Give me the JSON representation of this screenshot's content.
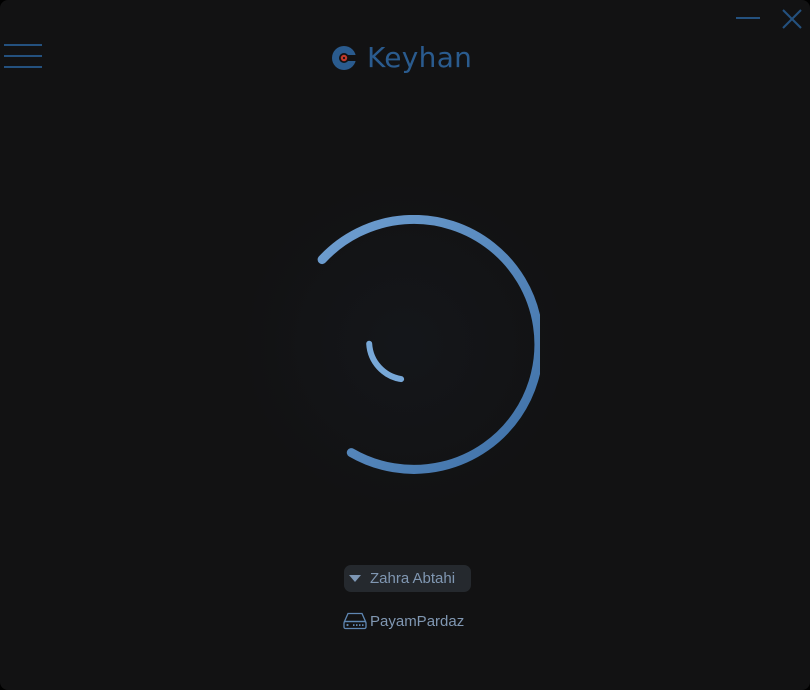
{
  "window": {
    "title": "Keyhan",
    "background": "#121213",
    "accent": "#2a5b8e"
  },
  "header": {
    "menu_icon": "hamburger-menu-icon",
    "logo_icon": "keyhan-logo-icon",
    "title": "Keyhan",
    "minimize_icon": "minimize-icon",
    "close_icon": "close-icon"
  },
  "status": {
    "state": "loading",
    "spinner_icon": "loading-spinner",
    "spinner_color": "#5b8cc2"
  },
  "account": {
    "dropdown_icon": "caret-down-icon",
    "user_name": "Zahra Abtahi",
    "device_icon": "network-device-icon",
    "device_name": "PayamPardaz"
  }
}
